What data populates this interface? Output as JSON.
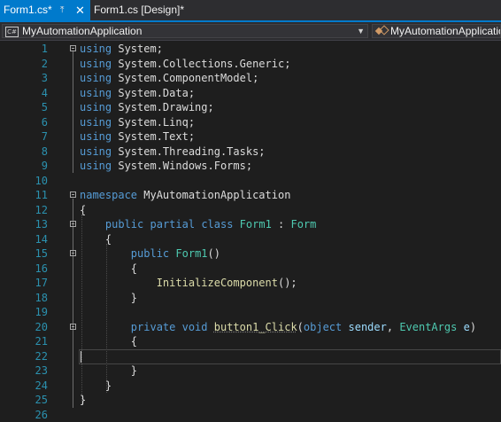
{
  "tabs": {
    "active": "Form1.cs*",
    "inactive": "Form1.cs [Design]*"
  },
  "icons": {
    "pin": "pin-icon",
    "close": "close-icon",
    "project": "csharp-project-icon",
    "class": "class-icon",
    "dropdown": "chevron-down-icon"
  },
  "navbar": {
    "project": "MyAutomationApplication",
    "type": "MyAutomationApplication"
  },
  "lines": [
    {
      "n": "1",
      "code": "using System;"
    },
    {
      "n": "2",
      "code": "using System.Collections.Generic;"
    },
    {
      "n": "3",
      "code": "using System.ComponentModel;"
    },
    {
      "n": "4",
      "code": "using System.Data;"
    },
    {
      "n": "5",
      "code": "using System.Drawing;"
    },
    {
      "n": "6",
      "code": "using System.Linq;"
    },
    {
      "n": "7",
      "code": "using System.Text;"
    },
    {
      "n": "8",
      "code": "using System.Threading.Tasks;"
    },
    {
      "n": "9",
      "code": "using System.Windows.Forms;"
    },
    {
      "n": "10",
      "code": ""
    },
    {
      "n": "11",
      "code": "namespace MyAutomationApplication"
    },
    {
      "n": "12",
      "code": "{"
    },
    {
      "n": "13",
      "code": "    public partial class Form1 : Form"
    },
    {
      "n": "14",
      "code": "    {"
    },
    {
      "n": "15",
      "code": "        public Form1()"
    },
    {
      "n": "16",
      "code": "        {"
    },
    {
      "n": "17",
      "code": "            InitializeComponent();"
    },
    {
      "n": "18",
      "code": "        }"
    },
    {
      "n": "19",
      "code": ""
    },
    {
      "n": "20",
      "code": "        private void button1_Click(object sender, EventArgs e)"
    },
    {
      "n": "21",
      "code": "        {"
    },
    {
      "n": "22",
      "code": ""
    },
    {
      "n": "23",
      "code": "        }"
    },
    {
      "n": "24",
      "code": "    }"
    },
    {
      "n": "25",
      "code": "}"
    },
    {
      "n": "26",
      "code": ""
    }
  ],
  "colors": {
    "accent": "#007acc",
    "keyword": "#569cd6",
    "type": "#4ec9b0",
    "method": "#dcdcaa",
    "identifier": "#9cdcfe",
    "lineNumber": "#2b91af"
  }
}
